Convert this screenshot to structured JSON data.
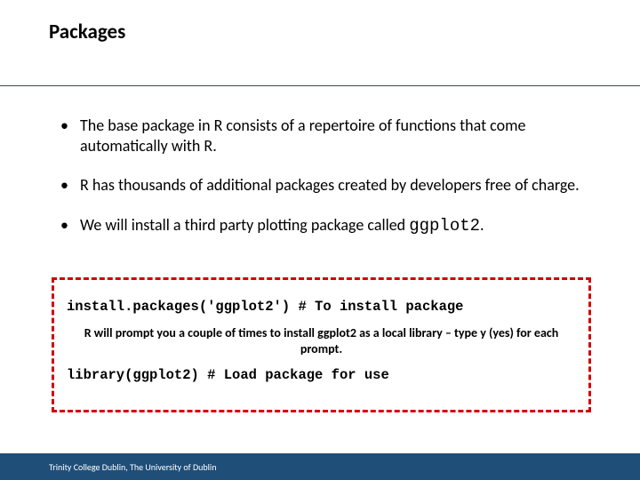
{
  "title": "Packages",
  "bullets": {
    "b0": "The base package in R consists of a repertoire of functions that come automatically with R.",
    "b1": "R has thousands of additional packages created by developers free of charge.",
    "b2_prefix": "We will install a third party plotting package called ",
    "b2_code": "ggplot2",
    "b2_suffix": "."
  },
  "redbox": {
    "install_line": "install.packages('ggplot2') # To install package",
    "note": "R will prompt you a couple of times to install ggplot2 as a local library – type y (yes) for each prompt.",
    "library_line": "library(ggplot2) # Load package for use"
  },
  "footer": "Trinity College Dublin, The University of Dublin"
}
